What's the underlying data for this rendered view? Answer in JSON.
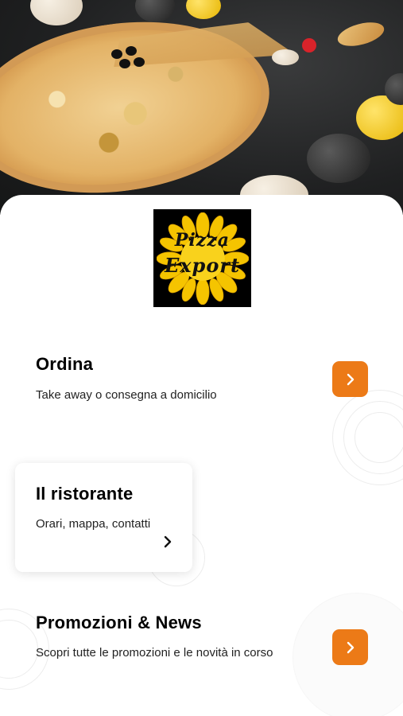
{
  "app": {
    "logo_text_line1": "Pizza",
    "logo_text_line2": "Export"
  },
  "sections": [
    {
      "title": "Ordina",
      "description": "Take away o consegna a domicilio",
      "action_icon": "chevron-right-icon"
    },
    {
      "title": "Il ristorante",
      "description": "Orari, mappa, contatti",
      "action_icon": "chevron-right-icon"
    },
    {
      "title": "Promozioni & News",
      "description": "Scopri tutte le promozioni e le novità in corso",
      "action_icon": "chevron-right-icon"
    }
  ],
  "colors": {
    "accent": "#ec7a17",
    "background": "#ffffff",
    "text": "#000000"
  }
}
